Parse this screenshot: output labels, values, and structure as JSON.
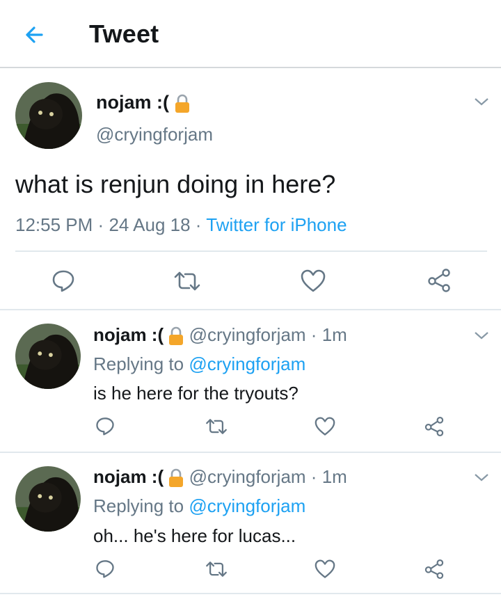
{
  "header": {
    "title": "Tweet"
  },
  "main_tweet": {
    "name": "nojam :(",
    "handle": "@cryingforjam",
    "text": "what is renjun doing in here?",
    "time": "12:55 PM",
    "date": "24 Aug 18",
    "sep": "·",
    "source": "Twitter for iPhone"
  },
  "replies": [
    {
      "name": "nojam :(",
      "handle": "@cryingforjam",
      "sep": "·",
      "age": "1m",
      "replying_prefix": "Replying to",
      "replying_handle": "@cryingforjam",
      "text": "is he here for the tryouts?"
    },
    {
      "name": "nojam :(",
      "handle": "@cryingforjam",
      "sep": "·",
      "age": "1m",
      "replying_prefix": "Replying to",
      "replying_handle": "@cryingforjam",
      "text": "oh... he's here for lucas..."
    }
  ],
  "colors": {
    "accent": "#1da1f2",
    "muted": "#657786",
    "text": "#14171a",
    "divider": "#e1e8ed",
    "lock": "#f4a62a"
  },
  "icons": [
    "back-arrow-icon",
    "chevron-down-icon",
    "lock-icon",
    "reply-icon",
    "retweet-icon",
    "like-icon",
    "share-icon"
  ]
}
